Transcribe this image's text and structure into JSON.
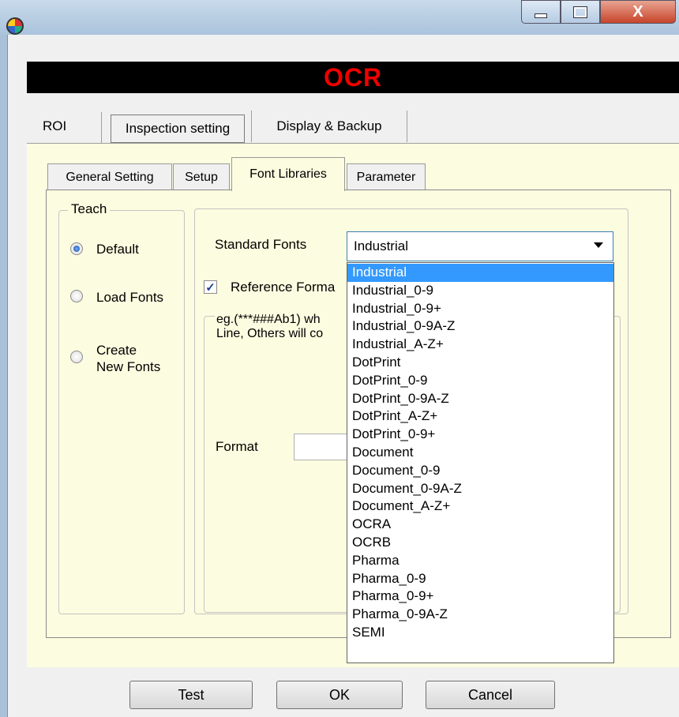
{
  "window": {
    "icon": "app-logo-icon",
    "controls": {
      "minimize": "minimize-icon",
      "maximize": "maximize-icon",
      "close": "X"
    }
  },
  "banner": {
    "title": "OCR",
    "color": "#e00000"
  },
  "outer_tabs": [
    {
      "label": "ROI",
      "active": false
    },
    {
      "label": "Inspection setting",
      "active": true
    },
    {
      "label": "Display & Backup",
      "active": false
    }
  ],
  "inner_tabs": [
    {
      "label": "General Setting",
      "active": false
    },
    {
      "label": "Setup",
      "active": false
    },
    {
      "label": "Font Libraries",
      "active": true
    },
    {
      "label": "Parameter",
      "active": false
    }
  ],
  "teach": {
    "legend": "Teach",
    "options": [
      {
        "label": "Default",
        "checked": true
      },
      {
        "label": "Load Fonts",
        "checked": false
      },
      {
        "label": "Create\nNew Fonts",
        "checked": false
      }
    ]
  },
  "standard_fonts": {
    "label": "Standard Fonts",
    "selected": "Industrial",
    "options": [
      "Industrial",
      "Industrial_0-9",
      "Industrial_0-9+",
      "Industrial_0-9A-Z",
      "Industrial_A-Z+",
      "DotPrint",
      "DotPrint_0-9",
      "DotPrint_0-9A-Z",
      "DotPrint_A-Z+",
      "DotPrint_0-9+",
      "Document",
      "Document_0-9",
      "Document_0-9A-Z",
      "Document_A-Z+",
      "OCRA",
      "OCRB",
      "Pharma",
      "Pharma_0-9",
      "Pharma_0-9+",
      "Pharma_0-9A-Z",
      "SEMI"
    ]
  },
  "reference_format": {
    "label": "Reference Forma",
    "checked": true
  },
  "description": {
    "line1": "eg.(***###Ab1) wh",
    "line2": "Line, Others will co"
  },
  "format": {
    "label": "Format",
    "value": ""
  },
  "buttons": {
    "test": "Test",
    "ok": "OK",
    "cancel": "Cancel"
  },
  "colors": {
    "selection": "#3399ff",
    "panel": "#fcfce0"
  }
}
